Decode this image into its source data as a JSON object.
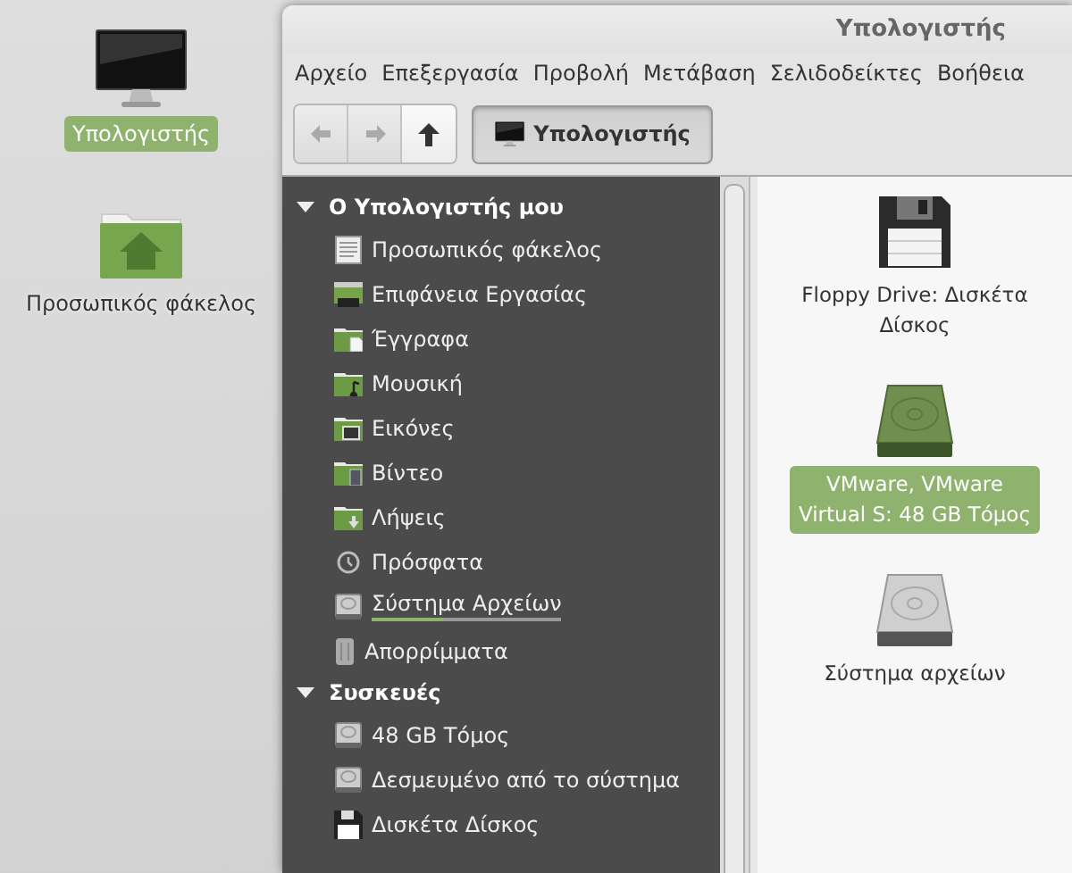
{
  "desktop": {
    "icons": [
      {
        "label": "Υπολογιστής",
        "kind": "computer",
        "selected": true
      },
      {
        "label": "Προσωπικός φάκελος",
        "kind": "home",
        "selected": false
      }
    ]
  },
  "window": {
    "title": "Υπολογιστής"
  },
  "menu": [
    "Αρχείο",
    "Επεξεργασία",
    "Προβολή",
    "Μετάβαση",
    "Σελιδοδείκτες",
    "Βοήθεια"
  ],
  "toolbar": {
    "buttons": [
      {
        "kind": "back",
        "disabled": true
      },
      {
        "kind": "forward",
        "disabled": true
      },
      {
        "kind": "up",
        "disabled": false
      }
    ],
    "location": {
      "label": "Υπολογιστής",
      "selected": true
    }
  },
  "sidebar": {
    "sections": [
      {
        "title": "Ο Υπολογιστής μου",
        "expanded": true,
        "items": [
          {
            "label": "Προσωπικός φάκελος",
            "kind": "home"
          },
          {
            "label": "Επιφάνεια Εργασίας",
            "kind": "desktop"
          },
          {
            "label": "Έγγραφα",
            "kind": "documents"
          },
          {
            "label": "Μουσική",
            "kind": "music"
          },
          {
            "label": "Εικόνες",
            "kind": "pictures"
          },
          {
            "label": "Βίντεο",
            "kind": "video"
          },
          {
            "label": "Λήψεις",
            "kind": "downloads"
          },
          {
            "label": "Πρόσφατα",
            "kind": "recent"
          },
          {
            "label": "Σύστημα Αρχείων",
            "kind": "drive",
            "level": 0.38
          },
          {
            "label": "Απορρίμματα",
            "kind": "trash"
          }
        ]
      },
      {
        "title": "Συσκευές",
        "expanded": true,
        "items": [
          {
            "label": "48 GB Τόμος",
            "kind": "drive"
          },
          {
            "label": "Δεσμευμένο από το σύστημα",
            "kind": "drive"
          },
          {
            "label": "Δισκέτα Δίσκος",
            "kind": "floppy"
          }
        ]
      }
    ]
  },
  "content": {
    "items": [
      {
        "label": "Floppy Drive: Δισκέτα Δίσκος",
        "kind": "floppy",
        "selected": false
      },
      {
        "label": "VMware, VMware Virtual S: 48 GB Τόμος",
        "kind": "hdd-green",
        "selected": true
      },
      {
        "label": "Σύστημα αρχείων",
        "kind": "hdd",
        "selected": false
      }
    ]
  }
}
